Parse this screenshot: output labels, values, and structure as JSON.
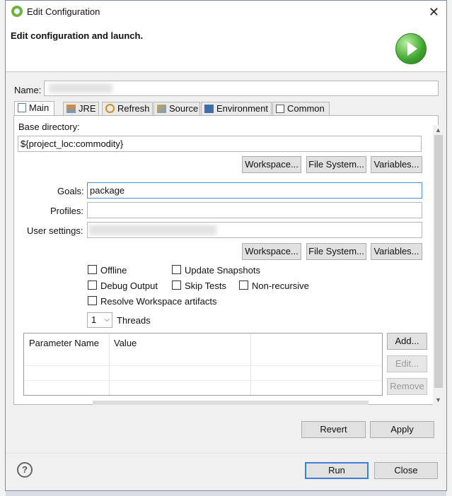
{
  "window": {
    "title": "Edit Configuration",
    "close_glyph": "✕"
  },
  "header": {
    "message": "Edit configuration and launch.",
    "icon": "run-icon"
  },
  "name": {
    "label": "Name:",
    "value": ""
  },
  "tabs": [
    {
      "label": "Main",
      "icon": "main-tab-icon",
      "active": true
    },
    {
      "label": "JRE",
      "icon": "jre-icon"
    },
    {
      "label": "Refresh",
      "icon": "refresh-icon"
    },
    {
      "label": "Source",
      "icon": "source-icon"
    },
    {
      "label": "Environment",
      "icon": "environment-icon"
    },
    {
      "label": "Common",
      "icon": "common-icon"
    }
  ],
  "main": {
    "base_dir_label": "Base directory:",
    "base_dir_value": "${project_loc:commodity}",
    "workspace_btn": "Workspace...",
    "filesystem_btn": "File System...",
    "variables_btn": "Variables...",
    "goals_label": "Goals:",
    "goals_value": "package",
    "profiles_label": "Profiles:",
    "profiles_value": "",
    "user_settings_label": "User settings:",
    "user_settings_value": "",
    "options": {
      "offline": "Offline",
      "update_snapshots": "Update Snapshots",
      "debug_output": "Debug Output",
      "skip_tests": "Skip Tests",
      "non_recursive": "Non-recursive",
      "resolve_workspace": "Resolve Workspace artifacts"
    },
    "threads_value": "1",
    "threads_label": "Threads",
    "table": {
      "col_param": "Parameter Name",
      "col_value": "Value"
    },
    "add_btn": "Add...",
    "edit_btn": "Edit...",
    "remove_btn": "Remove"
  },
  "actions": {
    "revert": "Revert",
    "apply": "Apply",
    "run": "Run",
    "close": "Close",
    "help": "?"
  }
}
